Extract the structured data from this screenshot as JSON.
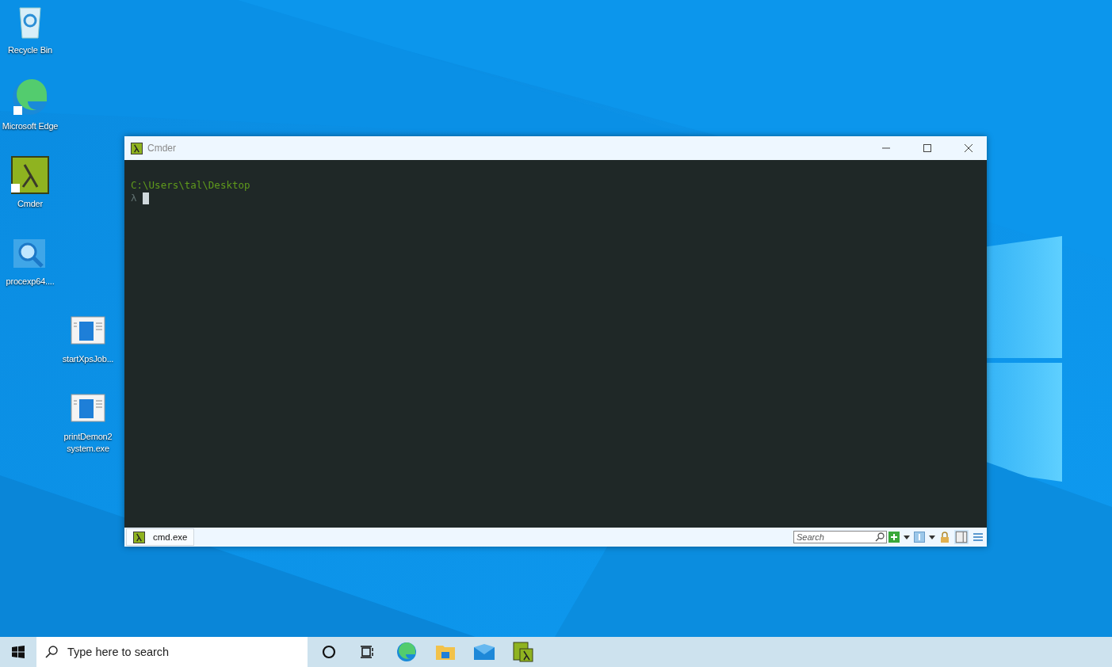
{
  "desktop_icons": [
    {
      "label": "Recycle Bin",
      "kind": "recycle"
    },
    {
      "label": "Microsoft Edge",
      "kind": "edge"
    },
    {
      "label": "Cmder",
      "kind": "cmder"
    },
    {
      "label": "procexp64....",
      "kind": "procexp"
    },
    {
      "label": "startXpsJob...",
      "kind": "exe"
    },
    {
      "label": "printDemon2 system.exe",
      "kind": "exe"
    }
  ],
  "window": {
    "title": "Cmder",
    "terminal": {
      "path": "C:\\Users\\tal\\Desktop",
      "prompt": "λ"
    },
    "tabs": [
      {
        "label": "cmd.exe",
        "selected": true
      }
    ],
    "search": {
      "placeholder": "Search"
    }
  },
  "taskbar": {
    "search": {
      "placeholder": "Type here to search"
    },
    "apps": [
      {
        "kind": "cortana"
      },
      {
        "kind": "taskview"
      },
      {
        "kind": "edge"
      },
      {
        "kind": "explorer"
      },
      {
        "kind": "mail"
      },
      {
        "kind": "cmder"
      }
    ]
  }
}
